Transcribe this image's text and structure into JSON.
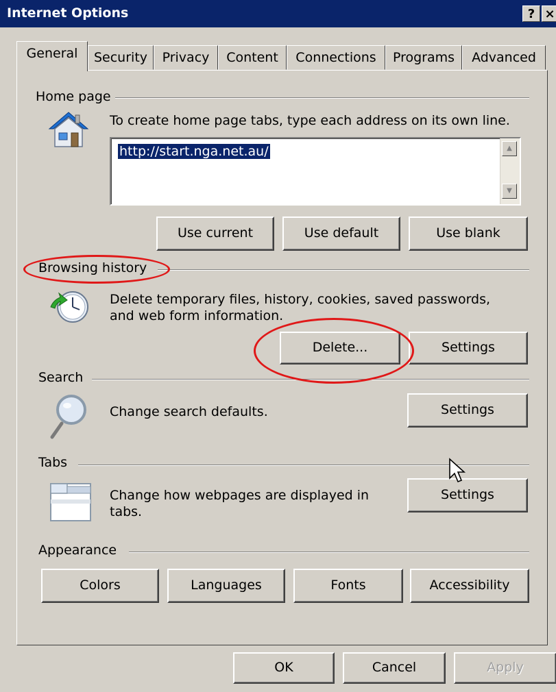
{
  "window": {
    "title": "Internet Options",
    "help_glyph": "?",
    "close_glyph": "×"
  },
  "tabs": [
    {
      "label": "General",
      "active": true
    },
    {
      "label": "Security"
    },
    {
      "label": "Privacy"
    },
    {
      "label": "Content"
    },
    {
      "label": "Connections"
    },
    {
      "label": "Programs"
    },
    {
      "label": "Advanced"
    }
  ],
  "home_page": {
    "group_label": "Home page",
    "description": "To create home page tabs, type each address on its own line.",
    "value": "http://start.nga.net.au/",
    "buttons": {
      "use_current": "Use current",
      "use_default": "Use default",
      "use_blank": "Use blank"
    }
  },
  "browsing_history": {
    "group_label": "Browsing history",
    "description_line1": "Delete temporary files, history, cookies, saved passwords,",
    "description_line2": "and web form information.",
    "delete_label": "Delete...",
    "settings_label": "Settings"
  },
  "search": {
    "group_label": "Search",
    "description": "Change search defaults.",
    "settings_label": "Settings"
  },
  "tabs_section": {
    "group_label": "Tabs",
    "description_line1": "Change how webpages are displayed in",
    "description_line2": "tabs.",
    "settings_label": "Settings"
  },
  "appearance": {
    "group_label": "Appearance",
    "buttons": {
      "colors": "Colors",
      "languages": "Languages",
      "fonts": "Fonts",
      "accessibility": "Accessibility"
    }
  },
  "footer": {
    "ok": "OK",
    "cancel": "Cancel",
    "apply": "Apply",
    "apply_enabled": false
  },
  "annotations": {
    "highlight_color": "#e01818"
  },
  "icons": [
    "home-icon",
    "history-clock-icon",
    "magnifier-icon",
    "tabs-icon",
    "mouse-cursor-icon"
  ]
}
